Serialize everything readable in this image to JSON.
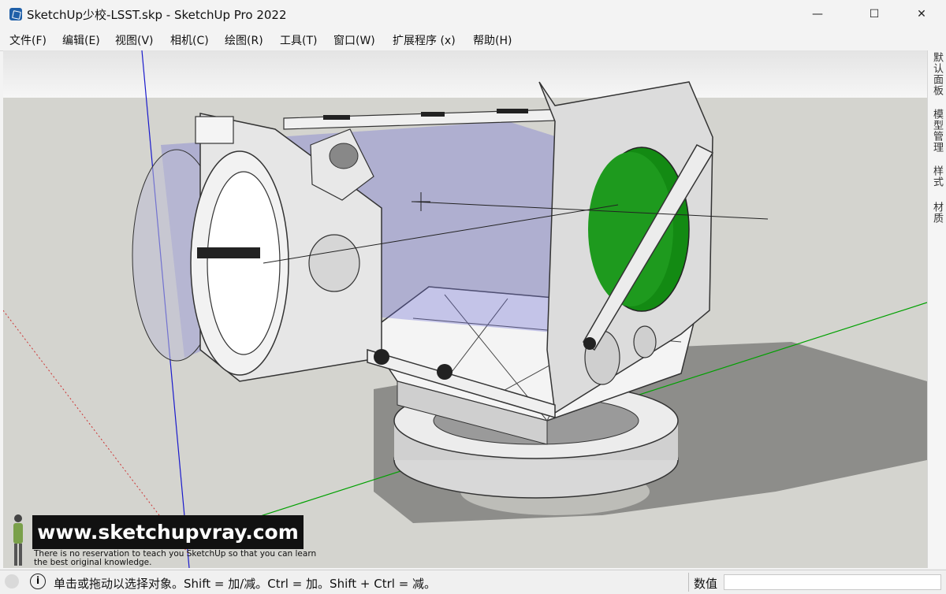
{
  "window": {
    "title": "SketchUp少校-LSST.skp - SketchUp Pro 2022",
    "minimize_glyph": "—",
    "maximize_glyph": "☐",
    "close_glyph": "✕"
  },
  "menu": {
    "items": [
      "文件(F)",
      "编辑(E)",
      "视图(V)",
      "相机(C)",
      "绘图(R)",
      "工具(T)",
      "窗口(W)",
      "扩展程序 (x)",
      "帮助(H)"
    ]
  },
  "tray": {
    "tabs": [
      "默认面板",
      "模型管理",
      "样式",
      "材质"
    ]
  },
  "viewport": {
    "watermark": "www.sketchupvray.com",
    "tagline": "There is no reservation to teach you SketchUp so that you can learn the best original knowledge.",
    "colors": {
      "sky": "#f2f2f2",
      "ground": "#d4d4cf",
      "x_axis": "#00a000",
      "y_axis": "#1a1acc",
      "z_axis_dotted": "#cc3333",
      "mirror_green": "#138a13",
      "light_beam": "#6a6ad0"
    }
  },
  "status": {
    "info_icon": "i",
    "hint": "单击或拖动以选择对象。Shift = 加/减。Ctrl = 加。Shift + Ctrl = 减。",
    "measure_label": "数值",
    "measure_value": ""
  }
}
